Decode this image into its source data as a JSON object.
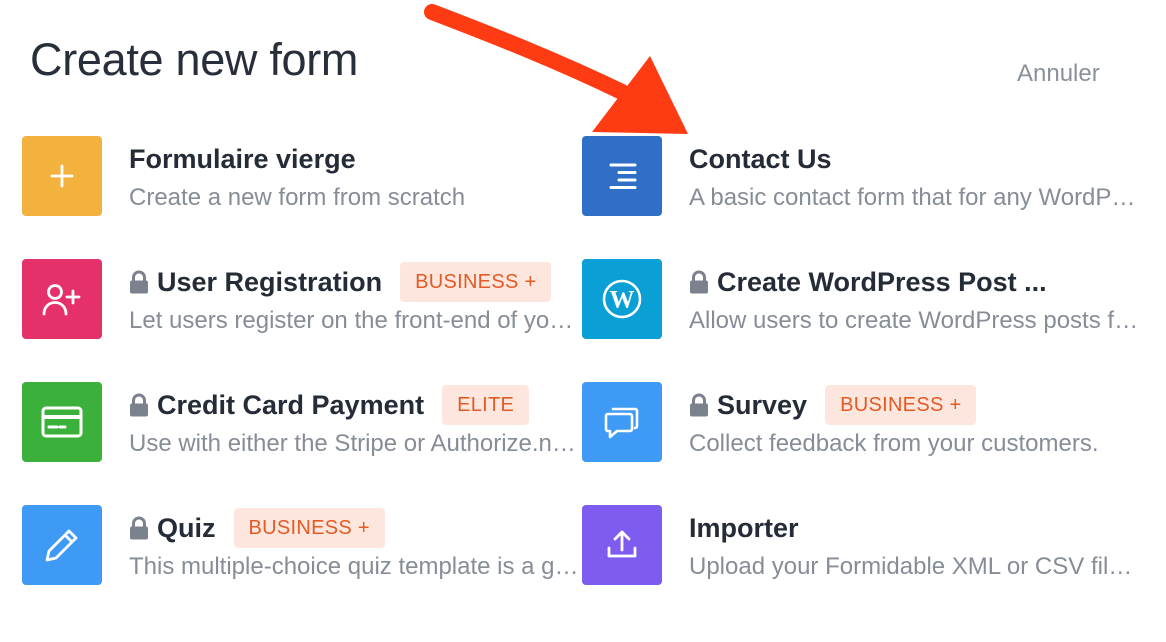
{
  "header": {
    "title": "Create new form",
    "cancel_label": "Annuler"
  },
  "colors": {
    "accent_arrow": "#ff3b14",
    "badge_bg": "#fde6dd",
    "badge_text": "#e45a24"
  },
  "templates": [
    {
      "title": "Formulaire vierge",
      "description": "Create a new form from scratch",
      "locked": false,
      "badge": "",
      "icon": "plus-icon",
      "color": "#f3b13e"
    },
    {
      "title": "Contact Us",
      "description": "A basic contact form that for any WordPress website.",
      "locked": false,
      "badge": "",
      "icon": "text-lines-icon",
      "color": "#2f6fc7"
    },
    {
      "title": "User Registration",
      "description": "Let users register on the front-end of your site.",
      "locked": true,
      "badge": "BUSINESS +",
      "icon": "user-plus-icon",
      "color": "#e6306a"
    },
    {
      "title": "Create WordPress Post ...",
      "description": "Allow users to create WordPress posts from the front-end.",
      "locked": true,
      "badge": "",
      "icon": "wordpress-icon",
      "color": "#0aa0d6"
    },
    {
      "title": "Credit Card Payment",
      "description": "Use with either the Stripe or Authorize.net add-on.",
      "locked": true,
      "badge": "ELITE",
      "icon": "credit-card-icon",
      "color": "#3bb13b"
    },
    {
      "title": "Survey",
      "description": "Collect feedback from your customers.",
      "locked": true,
      "badge": "BUSINESS +",
      "icon": "chat-bubbles-icon",
      "color": "#3f9af5"
    },
    {
      "title": "Quiz",
      "description": "This multiple-choice quiz template is a great start.",
      "locked": true,
      "badge": "BUSINESS +",
      "icon": "pencil-icon",
      "color": "#3f9af5"
    },
    {
      "title": "Importer",
      "description": "Upload your Formidable XML or CSV file to import forms.",
      "locked": false,
      "badge": "",
      "icon": "upload-icon",
      "color": "#7e5cf0"
    }
  ]
}
